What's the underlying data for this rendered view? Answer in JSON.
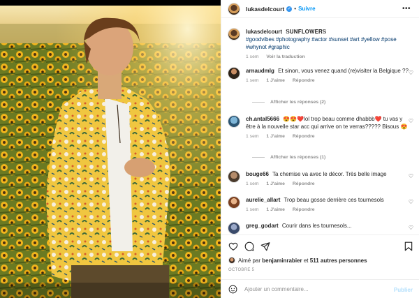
{
  "post": {
    "username": "lukasdelcourt",
    "follow_label": "Suivre",
    "dot": "•",
    "more_icon": "more-horizontal-icon"
  },
  "caption": {
    "username": "lukasdelcourt",
    "text_styled": "𝐒𝐔𝐍𝐅𝐋𝐎𝐖𝐄𝐑𝐒",
    "hashtags": "#goodvibes #photography #actor #sunset #art #yellow #pose #whynot #graphic",
    "time": "1 sem",
    "translate": "Voir la traduction"
  },
  "comments": [
    {
      "username": "arnaudmlg",
      "text": "Et sinon, vous venez quand (re)visiter la Belgique ??",
      "time": "1 sem",
      "likes": "1 J'aime",
      "reply": "Répondre",
      "replies": "Afficher les réponses (2)"
    },
    {
      "username": "ch.antal5666",
      "text": "😍😍❤️lol trop beau comme dhabbb❤️ tu vas y être à la nouvelle star acc qui arrive on te verras????? Bisous 😍",
      "time": "1 sem",
      "likes": "1 J'aime",
      "reply": "Répondre",
      "replies": "Afficher les réponses (1)"
    },
    {
      "username": "bouge66",
      "text": "Ta chemise va avec le décor. Très belle image",
      "time": "1 sem",
      "likes": "1 J'aime",
      "reply": "Répondre"
    },
    {
      "username": "aurelie_allart",
      "text": "Trop beau gosse derrière ces tournesols",
      "time": "1 sem",
      "likes": "1 J'aime",
      "reply": "Répondre"
    },
    {
      "username": "greg_godart",
      "text": "Courir dans les tournesols..."
    }
  ],
  "footer": {
    "liked_prefix": "Aimé par",
    "liked_user": "benjaminrabier",
    "liked_mid": "et",
    "liked_others": "511 autres personnes",
    "date": "OCTOBRE 5",
    "comment_placeholder": "Ajouter un commentaire...",
    "publish_label": "Publier"
  },
  "colors": {
    "accent": "#0095f6",
    "verified": "#3897f0",
    "publish_disabled": "#b2dffc",
    "muted": "#8e8e8e"
  }
}
